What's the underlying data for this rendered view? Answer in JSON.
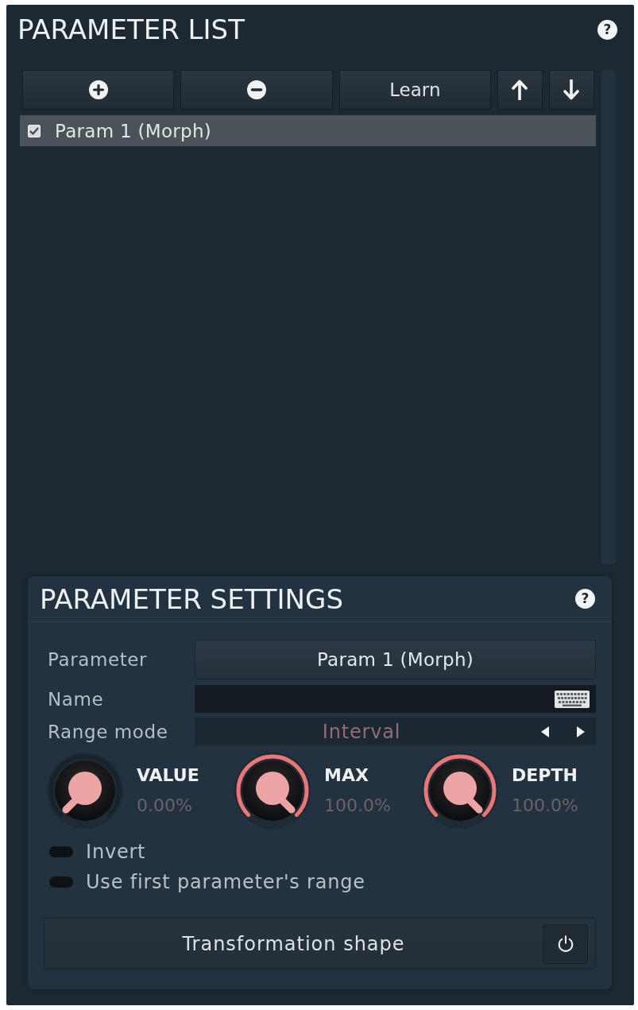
{
  "parameter_list": {
    "title": "PARAMETER LIST",
    "help": "?",
    "toolbar": [
      {
        "kind": "add"
      },
      {
        "kind": "remove"
      },
      {
        "kind": "learn",
        "label": "Learn"
      },
      {
        "kind": "up"
      },
      {
        "kind": "down"
      }
    ],
    "items": [
      {
        "label": "Param 1 (Morph)",
        "checked": true,
        "selected": true
      }
    ]
  },
  "parameter_settings": {
    "title": "PARAMETER SETTINGS",
    "help": "?",
    "fields": [
      {
        "kind": "dropdown",
        "label": "Parameter",
        "value": "Param 1 (Morph)"
      },
      {
        "kind": "text_input",
        "label": "Name"
      },
      {
        "kind": "selector",
        "label": "Range mode",
        "value": "Interval"
      }
    ],
    "knobs": [
      {
        "label": "VALUE",
        "reading": "0.00%",
        "level": 0
      },
      {
        "label": "MAX",
        "reading": "100.0%",
        "level": 1
      },
      {
        "label": "DEPTH",
        "reading": "100.0%",
        "level": 1
      }
    ],
    "toggles": [
      {
        "label": "Invert",
        "on": false
      },
      {
        "label": "Use first parameter's range",
        "on": false
      }
    ],
    "shape_button": {
      "label": "Transformation shape"
    }
  }
}
